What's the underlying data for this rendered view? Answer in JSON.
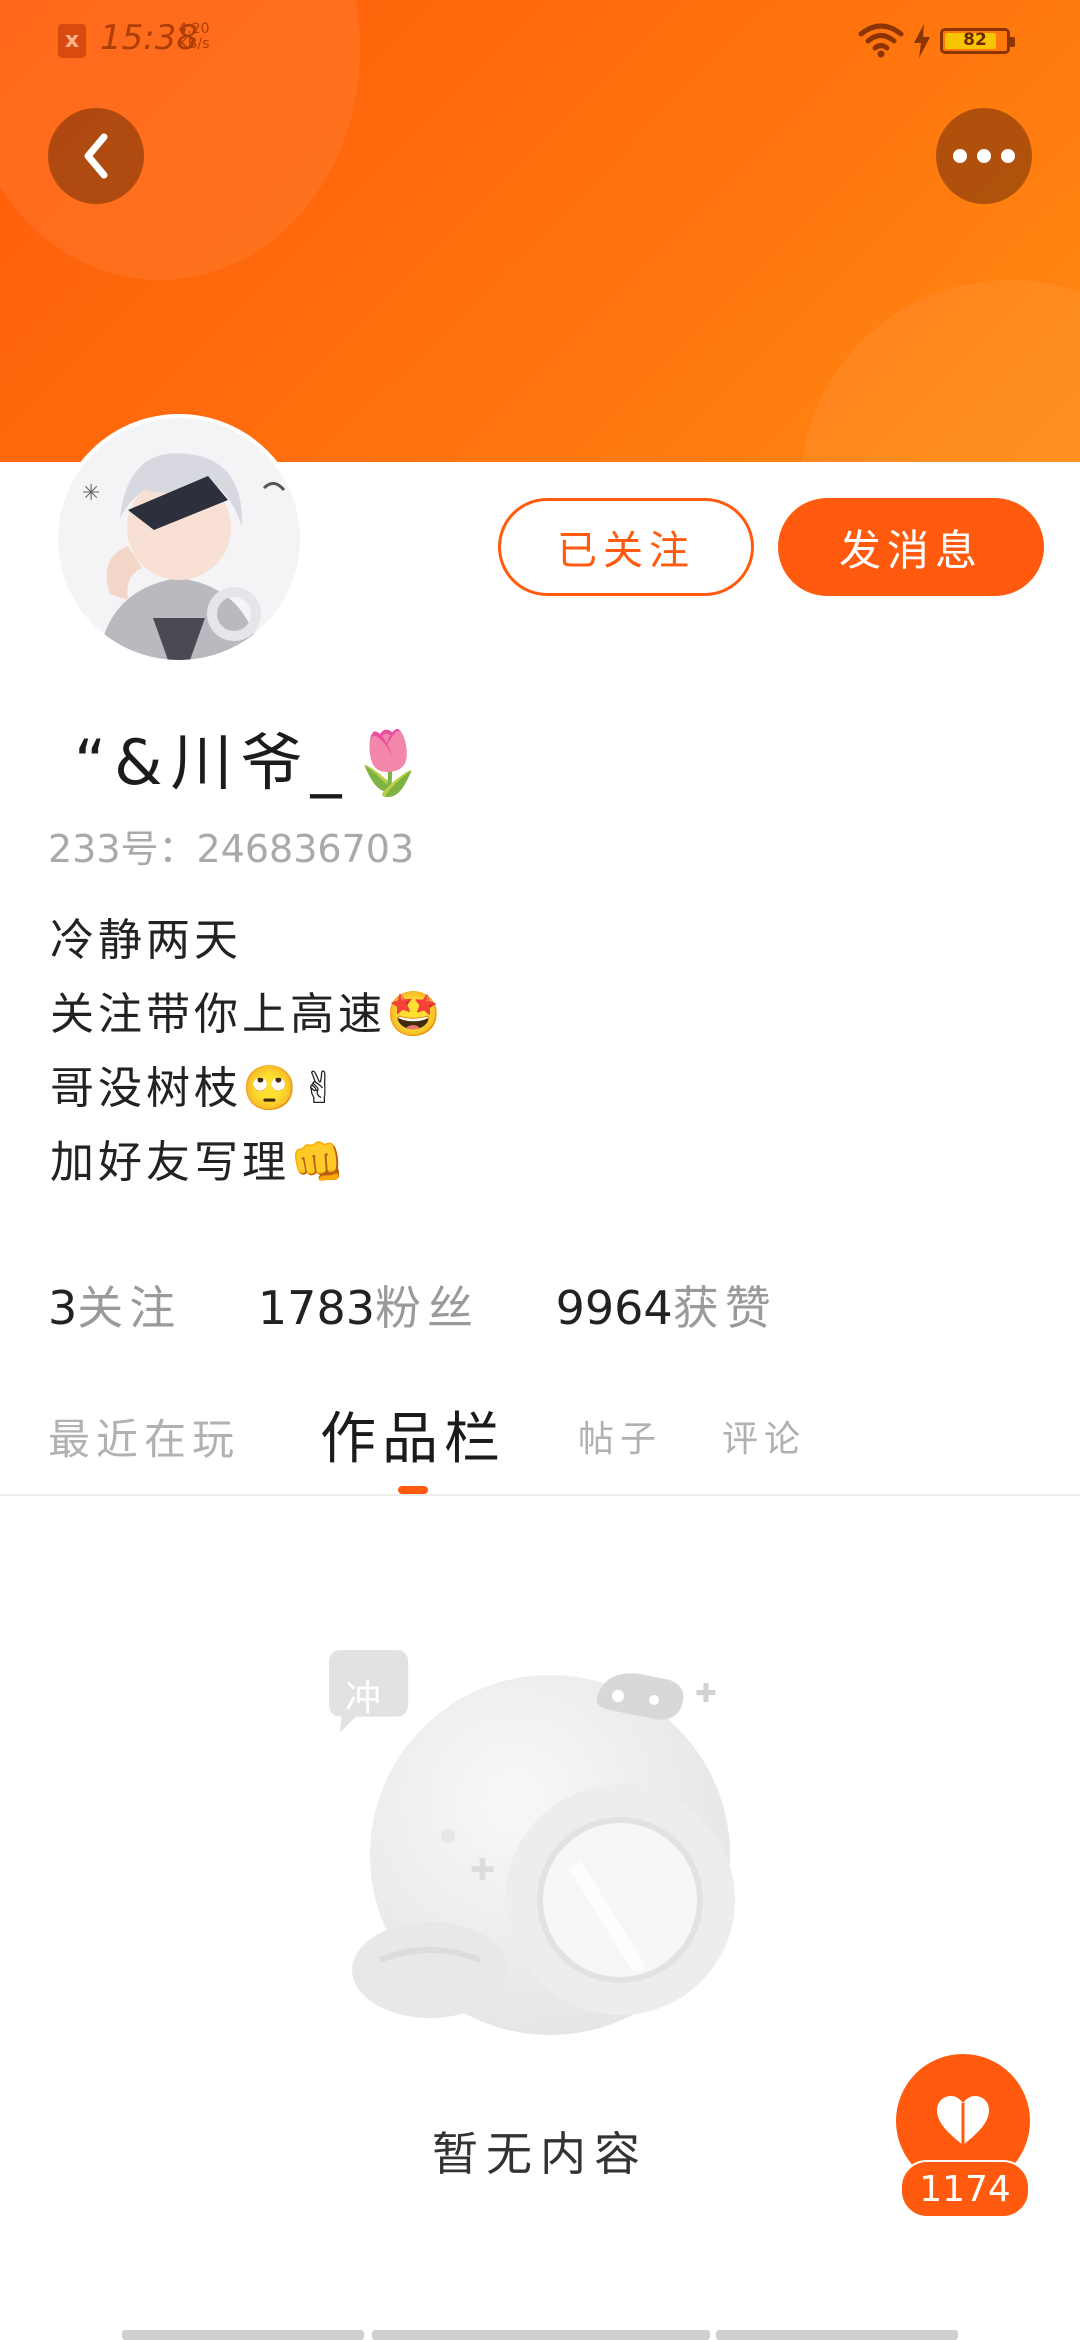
{
  "status_bar": {
    "time": "15:38",
    "speed_value": "4.20",
    "speed_unit": "KB/s",
    "battery": "82",
    "notice_icon": "x"
  },
  "header": {
    "back_icon": "chevron-left-icon",
    "more_icon": "more-dots-icon",
    "gradient_from": "#ff5c0a",
    "gradient_to": "#ff8a12"
  },
  "profile": {
    "follow_button": "已关注",
    "message_button": "发消息",
    "username": "“&川爷_🌷",
    "user_id": "233号：246836703",
    "bio": [
      "冷静两天",
      "关注带你上高速🤩",
      "哥没树枝🙄✌",
      "加好友写理👊"
    ],
    "stats": [
      {
        "num": "3",
        "label": "关注"
      },
      {
        "num": "1783",
        "label": "粉丝"
      },
      {
        "num": "9964",
        "label": "获赞"
      }
    ]
  },
  "tabs": [
    {
      "label": "最近在玩",
      "active": false
    },
    {
      "label": "作品栏",
      "active": true
    },
    {
      "label": "帖子",
      "active": false
    },
    {
      "label": "评论",
      "active": false
    }
  ],
  "empty_state": {
    "badge": "冲",
    "text": "暂无内容"
  },
  "like_button": {
    "icon": "heart-icon",
    "count": "1174"
  },
  "accent_color": "#ff5a0d"
}
